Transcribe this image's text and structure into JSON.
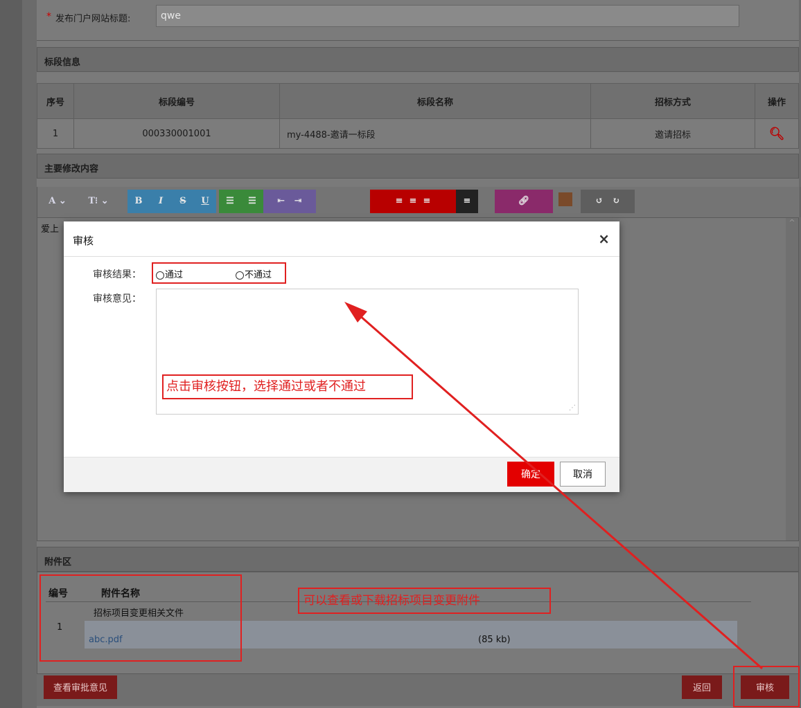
{
  "form": {
    "required_mark": "*",
    "title_label": "发布门户网站标题:",
    "title_value": "qwe"
  },
  "sections": {
    "bid_info": "标段信息",
    "modify_content": "主要修改内容",
    "attachments": "附件区"
  },
  "bid_table": {
    "headers": [
      "序号",
      "标段编号",
      "标段名称",
      "招标方式",
      "操作"
    ],
    "rows": [
      {
        "index": "1",
        "code": "000330001001",
        "name": "my-4488-邀请一标段",
        "method": "邀请招标",
        "action_icon": "search-icon"
      }
    ]
  },
  "toolbar": {
    "font": "A ⌄",
    "size": "T⁝ ⌄",
    "bold": "B",
    "italic": "I",
    "strike": "S",
    "underline": "U",
    "ul": "☰",
    "ol": "☰",
    "undo": "↺",
    "redo": "↻",
    "colors": {
      "blue": "#3a7faa",
      "green": "#3a8a3a",
      "purple": "#6a5a9a",
      "red": "#b80000",
      "dark": "#222222",
      "magenta": "#8a2a6a",
      "brown": "#7a4a2a",
      "gray": "#5e5e5e"
    }
  },
  "editor": {
    "text": "爱上"
  },
  "modal": {
    "title": "审核",
    "result_label": "审核结果：",
    "pass_option": "通过",
    "fail_option": "不通过",
    "opinion_label": "审核意见：",
    "confirm": "确定",
    "cancel": "取消",
    "note": "点击审核按钮，选择通过或者不通过"
  },
  "attachments": {
    "col_no": "编号",
    "col_name": "附件名称",
    "doc_title": "招标项目变更相关文件",
    "row_no": "1",
    "file_name": "abc.pdf",
    "file_size": "(85 kb)",
    "note": "可以查看或下载招标项目变更附件"
  },
  "buttons": {
    "view_opinion": "查看审批意见",
    "back": "返回",
    "audit": "审核"
  },
  "annotation_color": "#e02020"
}
